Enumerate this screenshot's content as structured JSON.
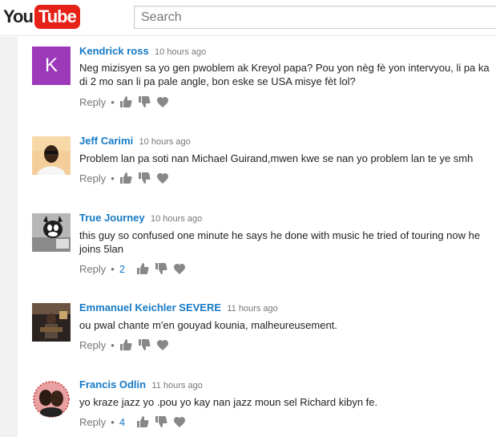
{
  "header": {
    "logo_you": "You",
    "logo_tube": "Tube",
    "search_placeholder": "Search"
  },
  "comments": [
    {
      "author": "Kendrick ross",
      "time": "10 hours ago",
      "avatar_letter": "K",
      "text": "Neg mizisyen sa yo gen pwoblem ak Kreyol papa? Pou yon nèg fè yon intervyou, li pa ka di 2 mo san li pa pale angle, bon eske se USA misye fèt lol?",
      "reply_label": "Reply",
      "like_count": ""
    },
    {
      "author": "Jeff Carimi",
      "time": "10 hours ago",
      "text": "Problem lan pa soti nan Michael Guirand,mwen kwe se nan yo problem lan te ye smh",
      "reply_label": "Reply",
      "like_count": ""
    },
    {
      "author": "True Journey",
      "time": "10 hours ago",
      "text": "this guy so confused one minute he says he done with music he tried of touring now he joins 5lan",
      "reply_label": "Reply",
      "like_count": "2"
    },
    {
      "author": "Emmanuel Keichler SEVERE",
      "time": "11 hours ago",
      "text": "ou pwal chante m'en gouyad kounia, malheureusement.",
      "reply_label": "Reply",
      "like_count": ""
    },
    {
      "author": "Francis Odlin",
      "time": "11 hours ago",
      "text": "yo kraze jazz yo .pou yo kay nan jazz moun sel Richard kibyn fe.",
      "reply_label": "Reply",
      "like_count": "4"
    }
  ],
  "icons": {
    "like": "thumbs-up-icon",
    "dislike": "thumbs-down-icon",
    "heart": "heart-icon"
  },
  "colors": {
    "brand_red": "#e62117",
    "author_blue": "#167ac6",
    "avatar_purple": "#9c39b8"
  }
}
